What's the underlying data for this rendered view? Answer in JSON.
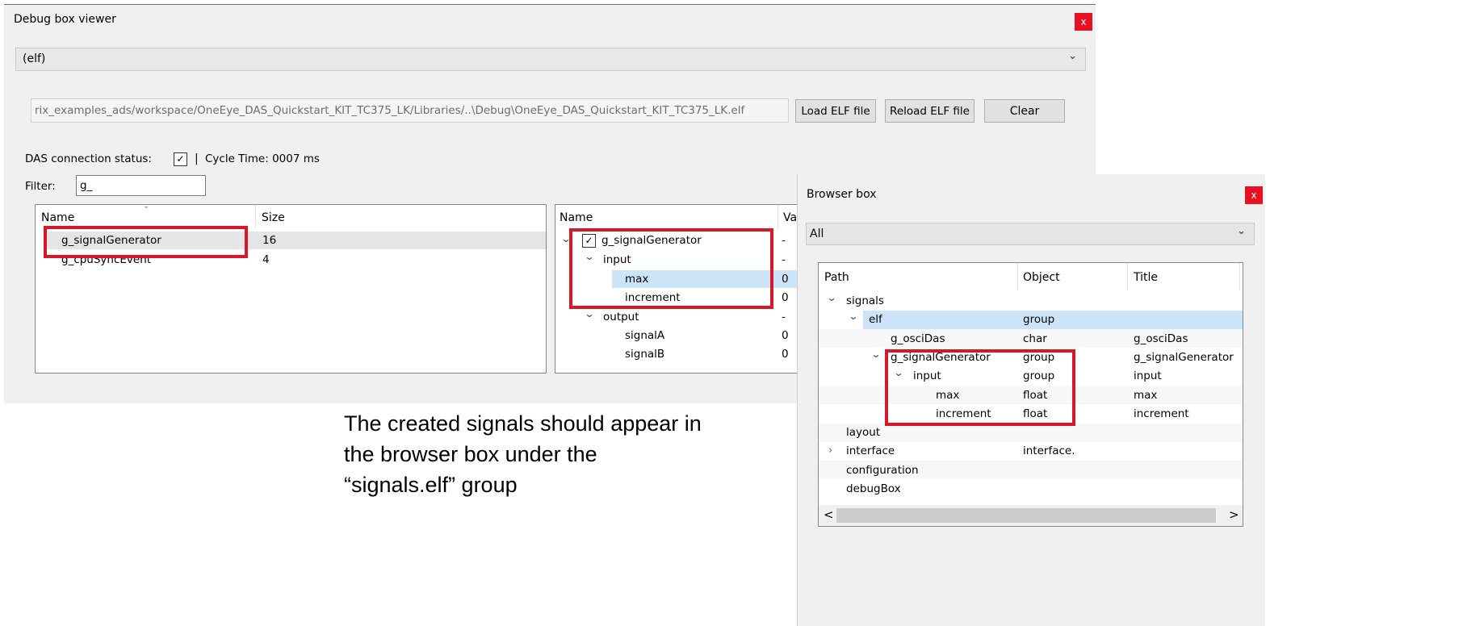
{
  "debug_window": {
    "title": "Debug box viewer",
    "close_label": "x",
    "elf_combo_value": "(elf)",
    "elf_path": "rix_examples_ads/workspace/OneEye_DAS_Quickstart_KIT_TC375_LK/Libraries/..\\Debug\\OneEye_DAS_Quickstart_KIT_TC375_LK.elf",
    "buttons": {
      "load": "Load ELF file",
      "reload": "Reload ELF file",
      "clear": "Clear"
    },
    "status_label": "DAS connection status:",
    "status_checkbox": "✓",
    "separator": "|",
    "cycle_time": "Cycle Time: 0007 ms",
    "filter_label": "Filter:",
    "filter_value": "g_",
    "left_table": {
      "headers": {
        "name": "Name",
        "size": "Size"
      },
      "rows": [
        {
          "name": "g_signalGenerator",
          "size": "16"
        },
        {
          "name": "g_cpuSyncEvent",
          "size": "4"
        }
      ]
    },
    "right_tree": {
      "headers": {
        "name": "Name",
        "value": "Val"
      },
      "rows": [
        {
          "name": "g_signalGenerator",
          "value": "-"
        },
        {
          "name": "input",
          "value": "-"
        },
        {
          "name": "max",
          "value": "0"
        },
        {
          "name": "increment",
          "value": "0"
        },
        {
          "name": "output",
          "value": "-"
        },
        {
          "name": "signalA",
          "value": "0"
        },
        {
          "name": "signalB",
          "value": "0"
        }
      ]
    }
  },
  "caption": {
    "line1": "The created signals should appear in",
    "line2": "the browser box under the",
    "line3": "“signals.elf” group"
  },
  "browser_window": {
    "title": "Browser box",
    "close_label": "x",
    "combo_value": "All",
    "headers": {
      "path": "Path",
      "object": "Object",
      "title": "Title"
    },
    "rows": [
      {
        "path": "signals",
        "object": "",
        "title": ""
      },
      {
        "path": "elf",
        "object": "group",
        "title": ""
      },
      {
        "path": "g_osciDas",
        "object": "char",
        "title": "g_osciDas"
      },
      {
        "path": "g_signalGenerator",
        "object": "group",
        "title": "g_signalGenerator"
      },
      {
        "path": "input",
        "object": "group",
        "title": "input"
      },
      {
        "path": "max",
        "object": "float",
        "title": "max"
      },
      {
        "path": "increment",
        "object": "float",
        "title": "increment"
      },
      {
        "path": "layout",
        "object": "",
        "title": ""
      },
      {
        "path": "interface",
        "object": "interface.",
        "title": ""
      },
      {
        "path": "configuration",
        "object": "",
        "title": ""
      },
      {
        "path": "debugBox",
        "object": "",
        "title": ""
      }
    ],
    "scroll_left": "<",
    "scroll_right": ">"
  },
  "colors": {
    "highlight_red": "#d7182a",
    "selection_blue": "#cce4f7",
    "close_red": "#e81123"
  }
}
